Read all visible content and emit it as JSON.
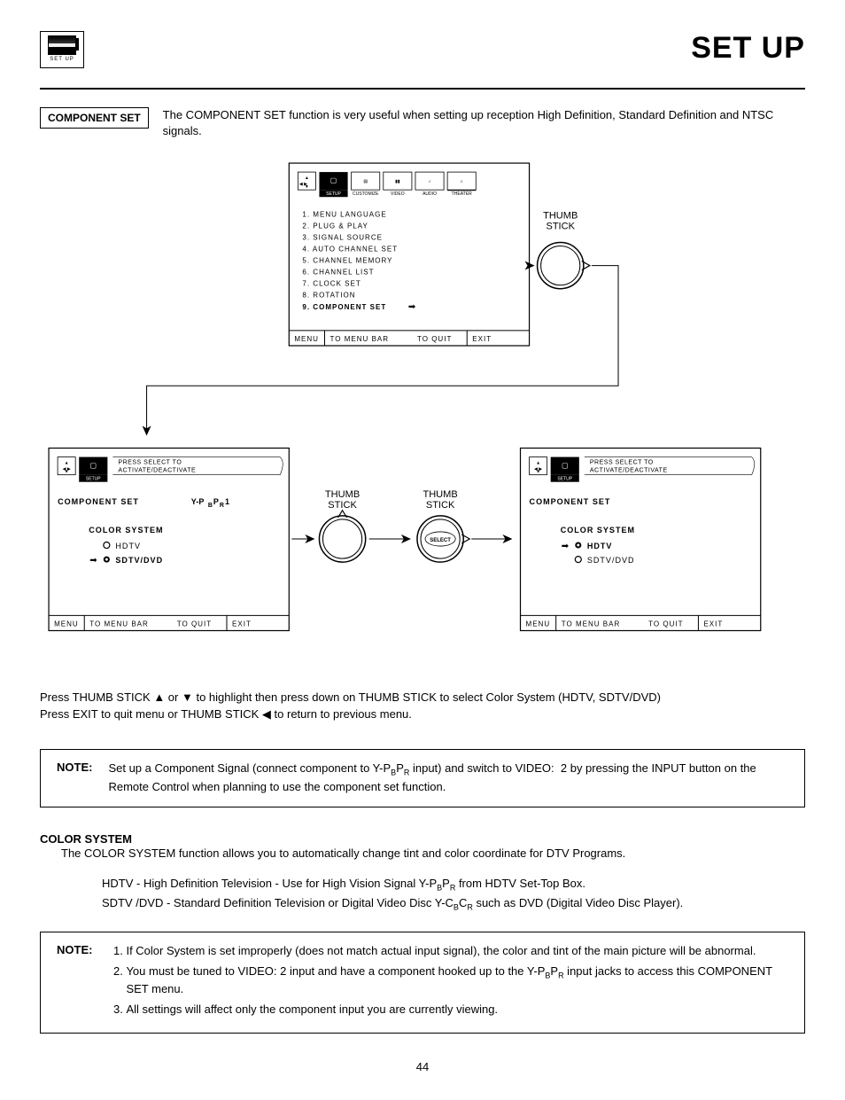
{
  "header": {
    "badge_label": "SET UP",
    "page_title": "SET UP"
  },
  "intro": {
    "section_label": "COMPONENT SET",
    "text": "The COMPONENT SET function is very useful when setting up reception High Definition, Standard Definition and NTSC signals."
  },
  "diagram": {
    "top_screen": {
      "tabs": [
        "SETUP",
        "CUSTOMIZE",
        "VIDEO",
        "AUDIO",
        "THEATER"
      ],
      "menu_items": [
        "1. MENU LANGUAGE",
        "2. PLUG & PLAY",
        "3. SIGNAL SOURCE",
        "4. AUTO CHANNEL SET",
        "5. CHANNEL MEMORY",
        "6. CHANNEL LIST",
        "7. CLOCK SET",
        "8. ROTATION",
        "9. COMPONENT SET"
      ],
      "selected_idx": 8,
      "footer": [
        "MENU",
        "TO MENU BAR",
        "TO QUIT",
        "EXIT"
      ]
    },
    "thumb_label": "THUMB\nSTICK",
    "select_label": "SELECT",
    "left_screen": {
      "banner": "PRESS SELECT TO\nACTIVATE/DEACTIVATE",
      "tab": "SETUP",
      "title": "COMPONENT SET",
      "sub": "Y-PBPR1",
      "group": "COLOR SYSTEM",
      "opt1": "HDTV",
      "opt2": "SDTV/DVD",
      "selected": 1,
      "footer": [
        "MENU",
        "TO MENU BAR",
        "TO QUIT",
        "EXIT"
      ]
    },
    "right_screen": {
      "banner": "PRESS SELECT TO\nACTIVATE/DEACTIVATE",
      "tab": "SETUP",
      "title": "COMPONENT SET",
      "group": "COLOR SYSTEM",
      "opt1": "HDTV",
      "opt2": "SDTV/DVD",
      "selected": 0,
      "footer": [
        "MENU",
        "TO MENU BAR",
        "TO QUIT",
        "EXIT"
      ]
    }
  },
  "instructions": {
    "line1": "Press THUMB STICK ▲ or ▼ to highlight then press down on THUMB STICK to select Color System (HDTV, SDTV/DVD)",
    "line2": "Press EXIT to quit menu or THUMB STICK ◀ to return to previous menu."
  },
  "note1": {
    "label": "NOTE:",
    "text": "Set up a Component Signal (connect component to Y-PBPR input) and switch to VIDEO:  2 by pressing the INPUT button on the Remote Control when planning to use the component set function."
  },
  "color_system": {
    "heading": "COLOR SYSTEM",
    "intro": "The COLOR SYSTEM function allows you to automatically change tint and color coordinate for DTV Programs.",
    "hdtv": "HDTV - High Definition Television - Use for High Vision Signal Y-PBPR from HDTV Set-Top Box.",
    "sdtv": "SDTV /DVD - Standard Definition Television or Digital Video Disc Y-CBCR such as DVD (Digital Video Disc Player)."
  },
  "note2": {
    "label": "NOTE:",
    "items": [
      "If Color System is set improperly (does not match actual input signal), the color and tint of the main picture will be abnormal.",
      "You must be tuned to VIDEO: 2 input and have a component hooked up to the Y-PBPR input jacks to access this COMPONENT SET menu.",
      "All settings will affect only the component input you are currently viewing."
    ]
  },
  "page_number": "44"
}
